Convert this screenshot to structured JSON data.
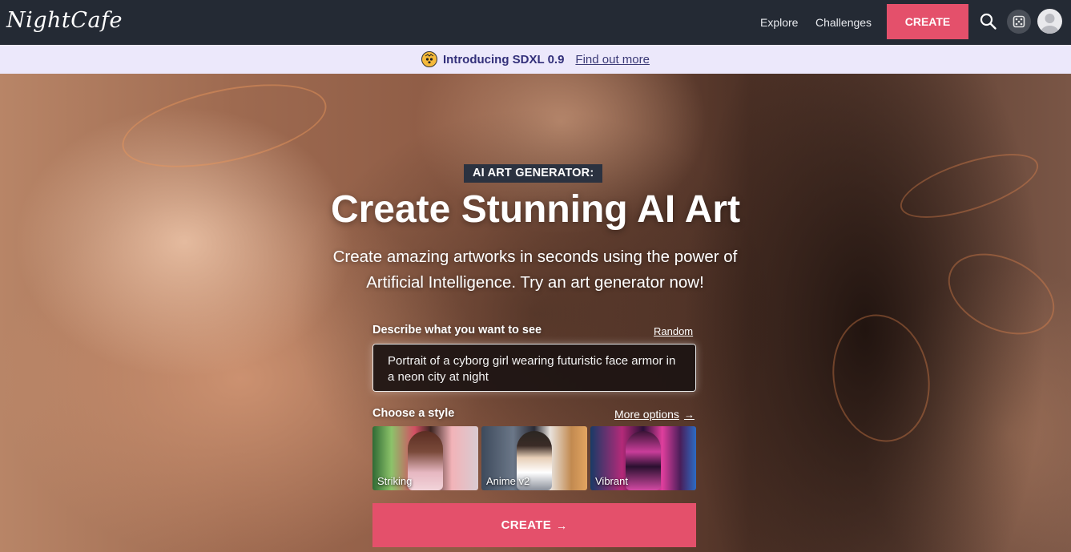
{
  "nav": {
    "logo": "NightCafe",
    "links": [
      {
        "label": "Explore"
      },
      {
        "label": "Challenges"
      }
    ],
    "create_label": "CREATE",
    "icons": [
      "search-icon",
      "dice-icon",
      "avatar-icon"
    ]
  },
  "announcement": {
    "emoji_icon": "mind-blown-emoji-icon",
    "text": "Introducing SDXL 0.9",
    "link": "Find out more"
  },
  "hero": {
    "tag": "AI ART GENERATOR:",
    "title": "Create Stunning AI Art",
    "subtitle": "Create amazing artworks in seconds using the power of Artificial Intelligence. Try an art generator now!"
  },
  "form": {
    "prompt_label": "Describe what you want to see",
    "random_label": "Random",
    "prompt_value": "Portrait of a cyborg girl wearing futuristic face armor in a neon city at night",
    "style_label": "Choose a style",
    "more_options_label": "More options",
    "styles": [
      {
        "label": "Striking"
      },
      {
        "label": "Anime v2"
      },
      {
        "label": "Vibrant"
      }
    ],
    "create_label": "CREATE"
  },
  "colors": {
    "accent": "#e4506b",
    "navbar": "#242a34",
    "announce_bg": "#ece8fb",
    "announce_text": "#33307a"
  }
}
